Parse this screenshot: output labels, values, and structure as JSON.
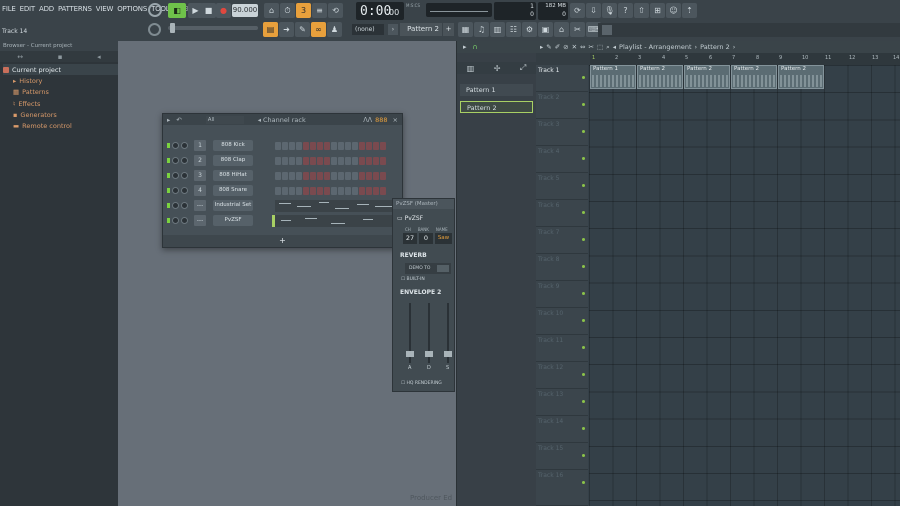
{
  "menu": [
    "FILE",
    "EDIT",
    "ADD",
    "PATTERNS",
    "VIEW",
    "OPTIONS",
    "TOOLS",
    "HELP"
  ],
  "transport": {
    "tempo": "90.000",
    "time": "0:00",
    "time_sub": "00",
    "time_unit": "M:S:CS",
    "cpu_top": "1",
    "cpu_bottom": "0",
    "ram_top": "182 MB",
    "ram_bottom": "0"
  },
  "hint": "Track 14",
  "pattern_selector": "Pattern 2",
  "mixer_target": "(none)",
  "browser": {
    "header": "Browser - Current project",
    "root": "Current project",
    "items": [
      "History",
      "Patterns",
      "Effects",
      "Generators",
      "Remote control"
    ]
  },
  "channel_rack": {
    "title": "Channel rack",
    "filter": "All",
    "bpm_label": "888",
    "channels": [
      {
        "num": "1",
        "name": "808 Kick"
      },
      {
        "num": "2",
        "name": "808 Clap"
      },
      {
        "num": "3",
        "name": "808 HiHat"
      },
      {
        "num": "4",
        "name": "808 Snare"
      },
      {
        "num": "---",
        "name": "Industrial Set"
      },
      {
        "num": "---",
        "name": "PvZSF"
      }
    ],
    "add_label": "+"
  },
  "plugin": {
    "title": "PvZSF (Master)",
    "name": "PvZSF",
    "labels": [
      "CH",
      "BANK",
      "NAME"
    ],
    "ch": "27",
    "bank": "0",
    "preset": "Saw",
    "reverb": "REVERB",
    "demo_to": "DEMO TO",
    "built_in": "BUILT-IN",
    "envelope": "ENVELOPE 2",
    "sliders": [
      "A",
      "D",
      "S"
    ],
    "hq": "HQ RENDERING"
  },
  "patterns": [
    "Pattern 1",
    "Pattern 2"
  ],
  "playlist": {
    "title": "Playlist - Arrangement",
    "pattern": "Pattern 2",
    "ruler": [
      "1",
      "2",
      "3",
      "4",
      "5",
      "6",
      "7",
      "8",
      "9",
      "10",
      "11",
      "12",
      "13",
      "14"
    ],
    "tracks": [
      "Track 1",
      "Track 2",
      "Track 3",
      "Track 4",
      "Track 5",
      "Track 6",
      "Track 7",
      "Track 8",
      "Track 9",
      "Track 10",
      "Track 11",
      "Track 12",
      "Track 13",
      "Track 14",
      "Track 15",
      "Track 16"
    ],
    "clips": [
      "Pattern 1",
      "Pattern 2",
      "Pattern 2",
      "Pattern 2",
      "Pattern 2"
    ]
  },
  "watermark": "Producer Ed"
}
